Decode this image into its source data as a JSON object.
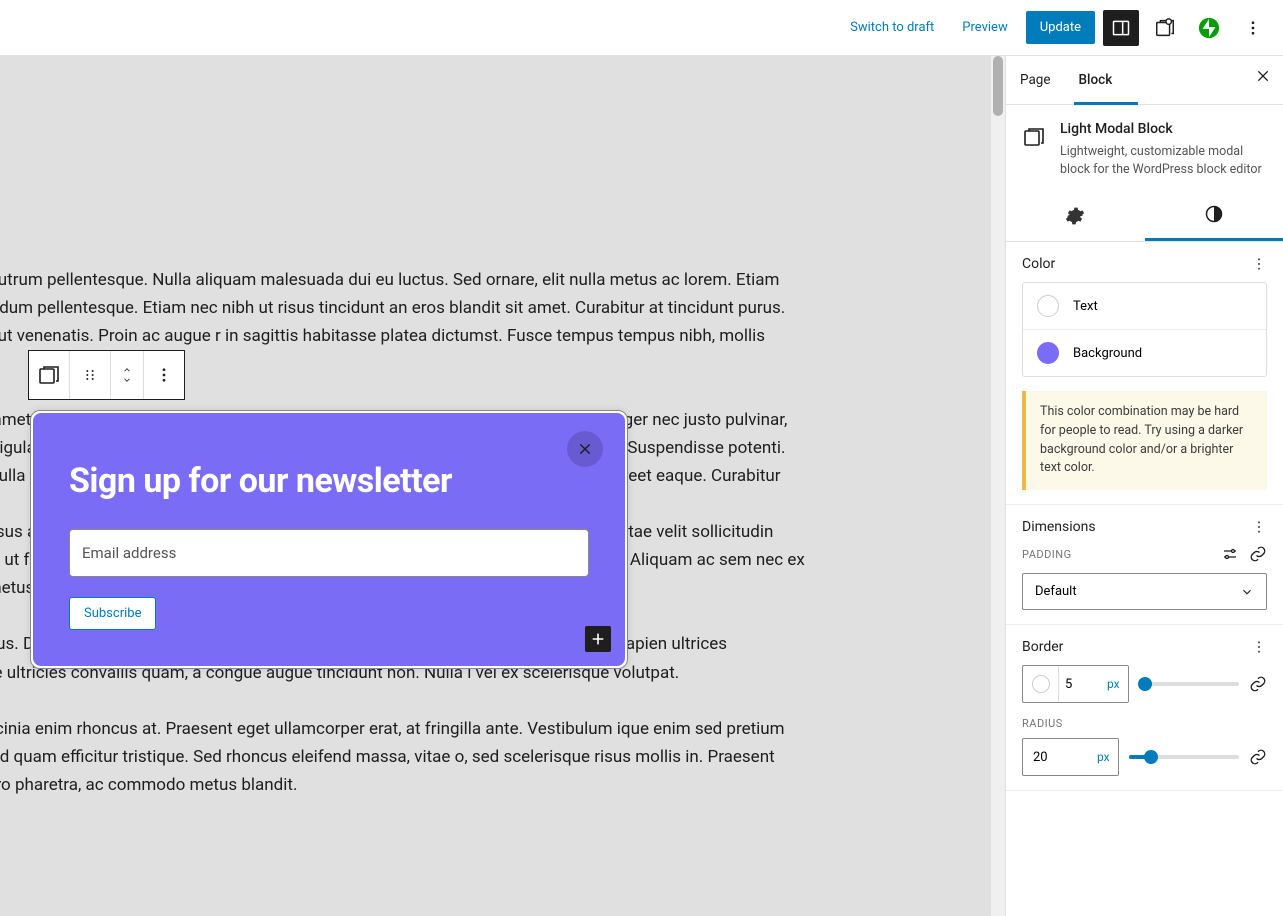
{
  "topbar": {
    "switch_draft": "Switch to draft",
    "preview": "Preview",
    "update": "Update"
  },
  "canvas": {
    "p1": "am feugiat ante ac leo rutrum pellentesque. Nulla aliquam malesuada dui eu luctus. Sed ornare, elit nulla metus ac lorem. Etiam dictum vitae nulla bibendum pellentesque. Etiam nec nibh ut risus tincidunt an eros blandit sit amet. Curabitur at tincidunt purus. Aenean congue et odio ut venenatis. Proin ac augue r in sagittis habitasse platea dictumst. Fusce tempus tempus nibh, mollis fermentum velit",
    "p2": " . Praesent ac turpis sit amet nunc varius lacinia. Vivamus ut tincidunt mauris, sollicitudin lectus ut gna. Integer nec justo pulvinar, efficitur orci a, dapibus ligula. Aliquam vulputate iaculis libero sed ctor eget, convallis et risus. Nulla facilisi. Suspendisse potenti. Integer ut tellus nulla. Nulla a enim ut lorem porta aliquet. Fusce venenatis enim lectus, at blandit lorem laoreet eaque. Curabitur",
    "p3": " Pellentesque pulvinar risus a ultricies vestibulum. Suspendisse potenti. Vestibulum. Quisque sagittis eros vitae velit sollicitudin lacinia. Ut volutpat, sem ut facilisis scelerisperdiet suscipit. od risus ante, eu pellentesque lectus sagittis in. Aliquam ac sem nec ex tempus mollis ut quis metus. Ut vitae",
    "p4": "is. Suspendisse a ex risus. Donec at commodo tortor. Aliquam semper felis tortor. Praesent aliquet sem sit apien ultrices commodo. Suspendisse ultricies convallis quam, a congue augue tincidunt non. Nulla i vel ex scelerisque volutpat.",
    "p5": "ibus ultricies lacus, a lacinia enim rhoncus at. Praesent eget ullamcorper erat, at fringilla ante. Vestibulum ique enim sed pretium aliquet. In mollis lorem id quam efficitur tristique. Sed rhoncus eleifend massa, vitae o, sed scelerisque risus mollis in. Praesent euismod quam nec libero pharetra, ac commodo metus blandit."
  },
  "modal": {
    "heading": "Sign up for our newsletter",
    "email_placeholder": "Email address",
    "subscribe": "Subscribe"
  },
  "sidebar": {
    "tab_page": "Page",
    "tab_block": "Block",
    "block_title": "Light Modal Block",
    "block_desc": "Lightweight, customizable modal block for the WordPress block editor",
    "color": {
      "heading": "Color",
      "text": "Text",
      "background": "Background",
      "warning": "This color combination may be hard for people to read. Try using a darker background color and/or a brighter text color."
    },
    "dimensions": {
      "heading": "Dimensions",
      "padding_label": "PADDING",
      "padding_value": "Default"
    },
    "border": {
      "heading": "Border",
      "value": "5",
      "unit": "px",
      "radius_label": "RADIUS",
      "radius_value": "20",
      "radius_unit": "px"
    }
  }
}
